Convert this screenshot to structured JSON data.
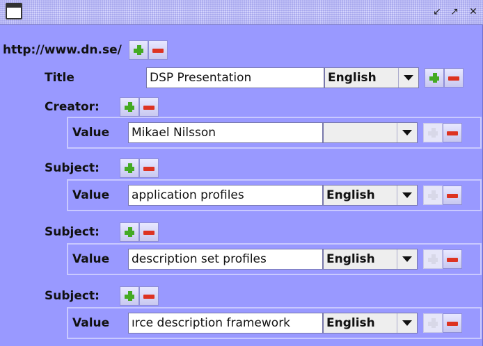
{
  "window": {
    "buttons": [
      "↙",
      "↗",
      "✕"
    ]
  },
  "root": {
    "url": "http://www.dn.se/"
  },
  "title": {
    "label": "Title",
    "value": "DSP Presentation",
    "language": "English"
  },
  "creator": {
    "label": "Creator:",
    "value_label": "Value",
    "value": "Mikael Nilsson",
    "language": ""
  },
  "subjects": [
    {
      "label": "Subject:",
      "value_label": "Value",
      "value": "application profiles",
      "language": "English"
    },
    {
      "label": "Subject:",
      "value_label": "Value",
      "value": "description set profiles",
      "language": "English"
    },
    {
      "label": "Subject:",
      "value_label": "Value",
      "value": "ırce description framework",
      "language": "English"
    }
  ]
}
